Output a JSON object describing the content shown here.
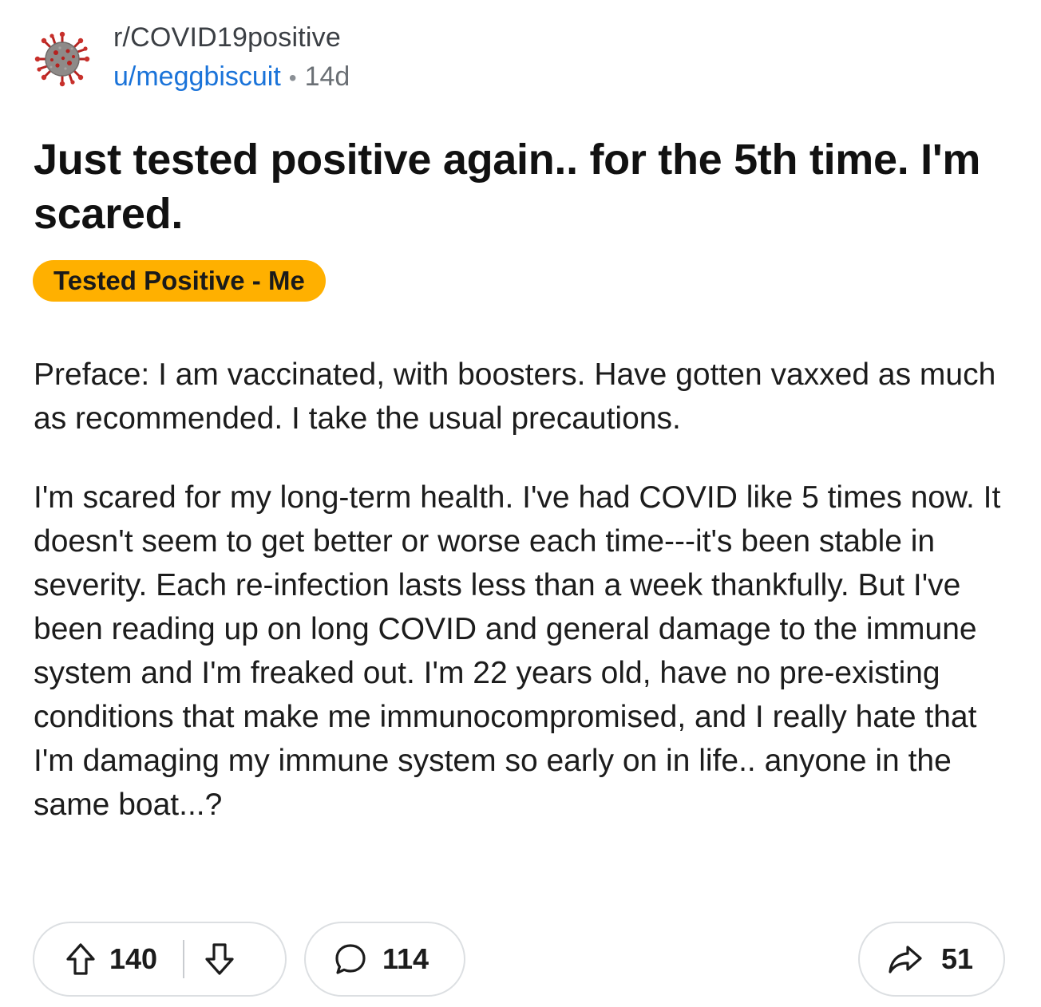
{
  "post": {
    "subreddit_prefix": "r/",
    "subreddit_name": "COVID19positive",
    "username": "u/meggbiscuit",
    "separator": "•",
    "age": "14d",
    "title": "Just tested positive again.. for the 5th time. I'm scared.",
    "flair": "Tested Positive - Me",
    "flair_color": "#ffb000",
    "body": [
      "Preface: I am vaccinated, with boosters. Have gotten vaxxed as much as recommended. I take the usual precautions.",
      "I'm scared for my long-term health. I've had COVID like 5 times now. It doesn't seem to get better or worse each time---it's been stable in severity. Each re-infection lasts less than a week thankfully. But I've been reading up on long COVID and general damage to the immune system and I'm freaked out. I'm 22 years old, have no pre-existing conditions that make me immunocompromised, and I really hate that I'm damaging my immune system so early on in life.. anyone in the same boat...?"
    ]
  },
  "actions": {
    "upvote_icon": "arrow-up-icon",
    "score": "140",
    "downvote_icon": "arrow-down-icon",
    "comment_icon": "speech-bubble-icon",
    "comments": "114",
    "share_icon": "share-arrow-icon",
    "shares": "51"
  },
  "colors": {
    "username_link": "#1a73d9",
    "pill_border": "#dcdfe2",
    "avatar_virus": "#b5221f"
  }
}
